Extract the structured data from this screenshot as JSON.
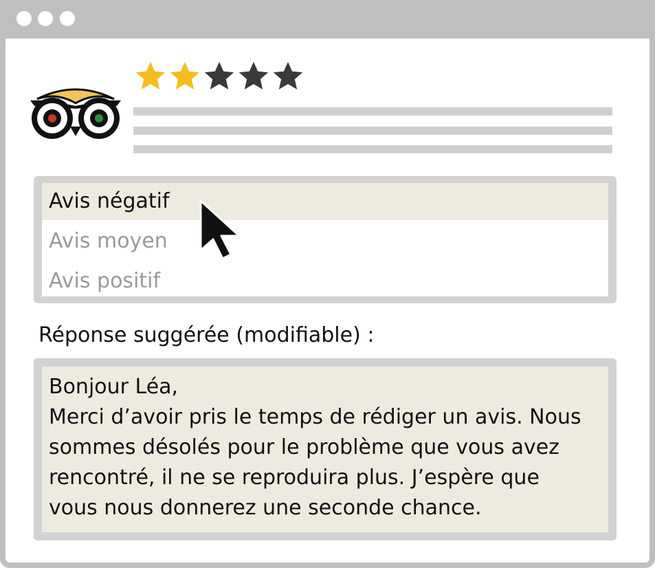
{
  "review": {
    "rating": 2,
    "max_rating": 5,
    "star_colors": {
      "filled": "#f5bd1e",
      "empty": "#3a3a3a"
    }
  },
  "logo": {
    "icon": "owl-eyes-logo",
    "colors": {
      "brow": "#f2c45a",
      "left_pupil": "#c0392b",
      "right_pupil": "#2e8b3a"
    }
  },
  "sentiment": {
    "options": [
      {
        "label": "Avis négatif",
        "selected": true
      },
      {
        "label": "Avis moyen",
        "selected": false
      },
      {
        "label": "Avis positif",
        "selected": false
      }
    ]
  },
  "response": {
    "label": "Réponse suggérée (modifiable) :",
    "lines": [
      "Bonjour Léa,",
      "Merci d’avoir pris le temps de rédiger un avis. Nous",
      "sommes désolés pour le problème que vous avez",
      "rencontré, il ne se reproduira plus. J’espère que",
      "vous nous donnerez une seconde chance."
    ]
  },
  "colors": {
    "frame": "#bfbfbf",
    "highlight": "#edeae0",
    "muted_text": "#9a9a9a"
  }
}
